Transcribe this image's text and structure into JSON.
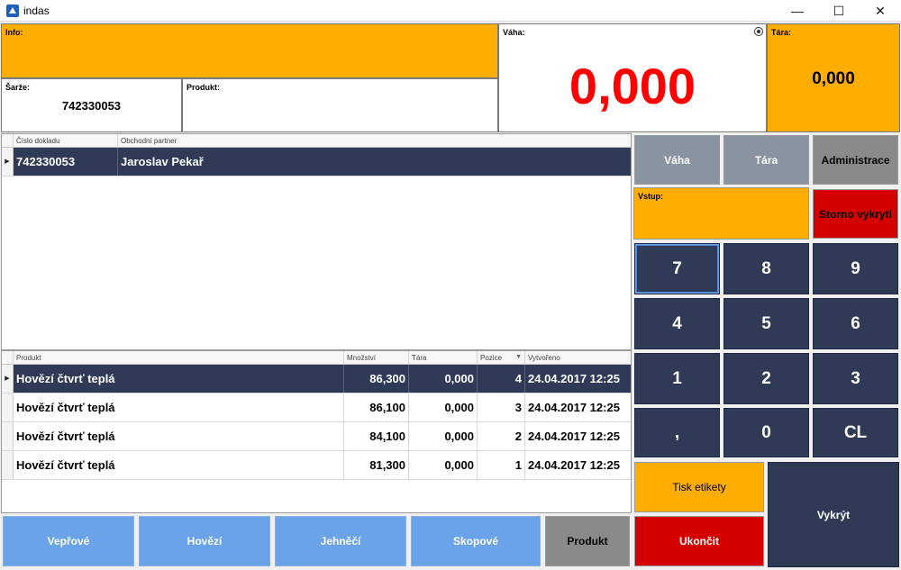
{
  "window": {
    "title": "indas",
    "minimize": "—",
    "maximize": "☐",
    "close": "✕"
  },
  "info": {
    "label": "Info:"
  },
  "sarze": {
    "label": "Šarže:",
    "value": "742330053"
  },
  "produkt": {
    "label": "Produkt:"
  },
  "vaha": {
    "label": "Váha:",
    "value": "0,000"
  },
  "tara": {
    "label": "Tára:",
    "value": "0,000"
  },
  "documents": {
    "headers": [
      "Číslo dokladu",
      "Obchodní partner"
    ],
    "rows": [
      {
        "cislo": "742330053",
        "partner": "Jaroslav Pekař",
        "indicator": "▶"
      }
    ]
  },
  "items": {
    "headers": [
      "Produkt",
      "Množství",
      "Tára",
      "Pozice",
      "Vytvořeno"
    ],
    "sort_indicator": "▼",
    "rows": [
      {
        "produkt": "Hovězí čtvrť teplá",
        "mnozstvi": "86,300",
        "tara": "0,000",
        "pozice": "4",
        "vytvoreno": "24.04.2017 12:25",
        "indicator": "▶"
      },
      {
        "produkt": "Hovězí čtvrť teplá",
        "mnozstvi": "86,100",
        "tara": "0,000",
        "pozice": "3",
        "vytvoreno": "24.04.2017 12:25",
        "indicator": ""
      },
      {
        "produkt": "Hovězí čtvrť teplá",
        "mnozstvi": "84,100",
        "tara": "0,000",
        "pozice": "2",
        "vytvoreno": "24.04.2017 12:25",
        "indicator": ""
      },
      {
        "produkt": "Hovězí čtvrť teplá",
        "mnozstvi": "81,300",
        "tara": "0,000",
        "pozice": "1",
        "vytvoreno": "24.04.2017 12:25",
        "indicator": ""
      }
    ]
  },
  "buttons": {
    "vaha": "Váha",
    "tara": "Tára",
    "administrace": "Administrace",
    "vstup": "Vstup:",
    "storno": "Storno vykrytí",
    "k7": "7",
    "k8": "8",
    "k9": "9",
    "k4": "4",
    "k5": "5",
    "k6": "6",
    "k1": "1",
    "k2": "2",
    "k3": "3",
    "comma": ",",
    "k0": "0",
    "cl": "CL",
    "tisk": "Tisk etikety",
    "vykryt": "Vykrýt",
    "ukoncit": "Ukončit",
    "veprove": "Vepřové",
    "hovezi": "Hovězí",
    "jehneci": "Jehněčí",
    "skopove": "Skopové",
    "produkt": "Produkt"
  },
  "colors": {
    "orange": "#ffad00",
    "navy": "#2e3a56",
    "red": "#d40000",
    "weight_red": "#ff0000",
    "blue": "#6aa3e8"
  }
}
